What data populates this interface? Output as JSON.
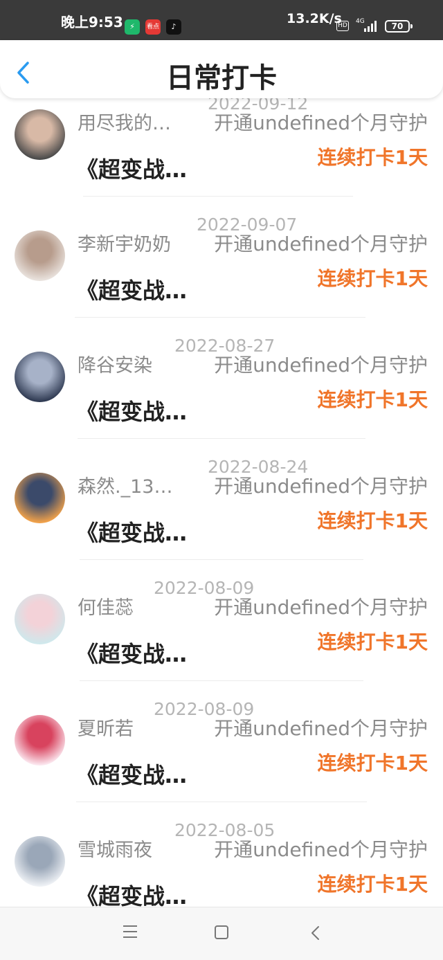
{
  "status_bar": {
    "time": "晚上9:53",
    "speed": "13.2K/s",
    "hd": "HD",
    "network": "4G",
    "battery": "70",
    "apps": [
      {
        "icon": "shield-app-icon",
        "color": "#1fb86b",
        "label": "⚡"
      },
      {
        "icon": "news-app-icon",
        "color": "#e53935",
        "label": "看点"
      },
      {
        "icon": "tiktok-app-icon",
        "color": "#111111",
        "label": "♪"
      }
    ]
  },
  "header": {
    "title": "日常打卡",
    "back_icon": "back-chevron-icon",
    "accent": "#2a9bf0"
  },
  "colors": {
    "streak": "#f0752a",
    "secondary": "#8b8b8b",
    "date": "#b5b5b5"
  },
  "items": [
    {
      "name": "用尽我的…",
      "date": "2022-09-12",
      "action": "开通undefined个月守护",
      "streak": "连续打卡1天",
      "book": "《超变战…",
      "avatar_colors": [
        "#4a4a4a",
        "#d8b9a6"
      ]
    },
    {
      "name": "李新宇奶奶",
      "date": "2022-09-07",
      "action": "开通undefined个月守护",
      "streak": "连续打卡1天",
      "book": "《超变战…",
      "avatar_colors": [
        "#e9e2dd",
        "#b79c8c"
      ]
    },
    {
      "name": "降谷安染",
      "date": "2022-08-27",
      "action": "开通undefined个月守护",
      "streak": "连续打卡1天",
      "book": "《超变战…",
      "avatar_colors": [
        "#2f3a52",
        "#a7b2c8"
      ]
    },
    {
      "name": "森然._13…",
      "date": "2022-08-24",
      "action": "开通undefined个月守护",
      "streak": "连续打卡1天",
      "book": "《超变战…",
      "avatar_colors": [
        "#f2a24a",
        "#3b4a6a"
      ]
    },
    {
      "name": "何佳蕊",
      "date": "2022-08-09",
      "action": "开通undefined个月守护",
      "streak": "连续打卡1天",
      "book": "《超变战…",
      "avatar_colors": [
        "#cfe8ec",
        "#f3d2d8"
      ]
    },
    {
      "name": "夏昕若",
      "date": "2022-08-09",
      "action": "开通undefined个月守护",
      "streak": "连续打卡1天",
      "book": "《超变战…",
      "avatar_colors": [
        "#fbe6ee",
        "#d8435e"
      ]
    },
    {
      "name": "雪城雨夜",
      "date": "2022-08-05",
      "action": "开通undefined个月守护",
      "streak": "连续打卡1天",
      "book": "《超变战…",
      "avatar_colors": [
        "#eef1f5",
        "#9aa7b8"
      ]
    }
  ]
}
